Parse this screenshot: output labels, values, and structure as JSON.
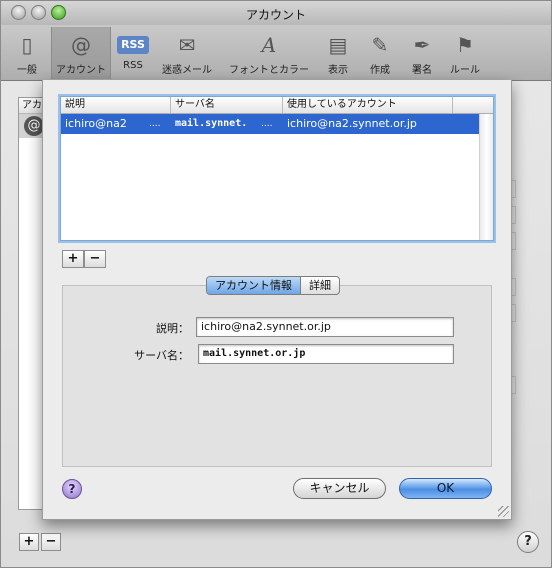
{
  "window": {
    "title": "アカウント"
  },
  "toolbar": {
    "items": [
      {
        "label": "一般",
        "icon": "switch-icon"
      },
      {
        "label": "アカウント",
        "icon": "at-sign-icon",
        "selected": true
      },
      {
        "label": "RSS",
        "icon": "rss-icon"
      },
      {
        "label": "迷惑メール",
        "icon": "junk-mail-icon"
      },
      {
        "label": "フォントとカラー",
        "icon": "font-icon"
      },
      {
        "label": "表示",
        "icon": "viewing-icon"
      },
      {
        "label": "作成",
        "icon": "composing-icon"
      },
      {
        "label": "署名",
        "icon": "signature-icon"
      },
      {
        "label": "ルール",
        "icon": "rules-icon"
      }
    ]
  },
  "background": {
    "list_header": "アカ",
    "add": "+",
    "remove": "−",
    "help": "?"
  },
  "sheet": {
    "table": {
      "columns": [
        "説明",
        "サーバ名",
        "使用しているアカウント"
      ],
      "rows": [
        {
          "description": "ichiro@na2",
          "ellipsis": "....",
          "server": "mail.synnet.",
          "ellipsis2": "....",
          "account": "ichiro@na2.synnet.or.jp"
        }
      ]
    },
    "add": "+",
    "remove": "−",
    "tabs": [
      "アカウント情報",
      "詳細"
    ],
    "fields": {
      "description_label": "説明：",
      "description_value": "ichiro@na2.synnet.or.jp",
      "server_label": "サーバ名：",
      "server_value": "mail.synnet.or.jp"
    },
    "help": "?",
    "cancel": "キャンセル",
    "ok": "OK"
  },
  "colors": {
    "selection": "#2e66cf",
    "ok_button": "#4c8fe4",
    "focus_ring": "#9bc1ea"
  }
}
